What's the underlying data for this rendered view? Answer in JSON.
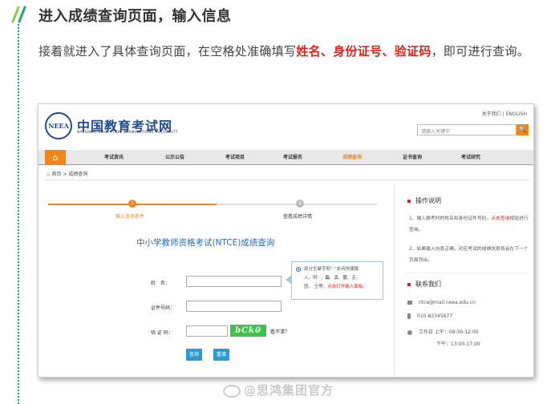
{
  "article": {
    "heading": "进入成绩查询页面，输入信息",
    "intro_before": "接着就进入了具体查询页面，在空格处准确填写",
    "intro_highlight": "姓名、身份证号、验证码",
    "intro_after": "，即可进行查询。"
  },
  "site": {
    "logo_mark": "NEEA",
    "logo_cn": "中国教育考试网",
    "logo_en": "NATIONAL EDUCATION EXAMINATIONS AUTHORITY",
    "top_links": "关于我们 | ENGLISH",
    "search_placeholder": "请输入关键字",
    "search_icon": "magnifier-icon",
    "accent_color": "#f08519",
    "brand_color": "#1f4c8f",
    "home_glyph": "⌂",
    "search_glyph": "🔍"
  },
  "nav": {
    "items": [
      "考试资讯",
      "公示公告",
      "考试项目",
      "考试报名",
      "成绩查询",
      "证书查询",
      "考试研究"
    ],
    "active": "成绩查询"
  },
  "breadcrumb": {
    "home_icon": "⌂",
    "text": "首页 > 成绩查询"
  },
  "steps": {
    "step1_num": "1",
    "step1_label": "输入查询条件",
    "step2_num": "2",
    "step2_label": "查看成绩详情"
  },
  "form": {
    "title": "中小学教师资格考试(NTCE)成绩查询",
    "name_label": "姓　名：",
    "id_label": "证件号码：",
    "captcha_label": "验 证 码：",
    "captcha_text": "bCk0",
    "captcha_tip": "看不清？",
    "query_button": "查询",
    "reset_button": "重填"
  },
  "hint": {
    "line1": "部分生僻字和“·”支持快捷输",
    "line2": "入，例：·、龘、䶮、䨻、㐊、",
    "line3": "㘝、 仝等，",
    "link": "点击打开输入面板。"
  },
  "sidebar": {
    "ops_title": "操作说明",
    "ops_1": "1、输入报考时的姓名和身份证件号码，",
    "ops_1_link": "点击查询",
    "ops_1_end": "按钮进行查询。",
    "ops_2": "2、如果输入信息正确，对应考试的成绩信息将会在下一个页面列出。",
    "contact_title": "联系我们",
    "email": "ntce@mail.neea.edu.cn",
    "phone": "010-82345677",
    "hours_1": "工作日 上午：08:30-12:00",
    "hours_2": "下午：13:00-17:00"
  },
  "watermark": {
    "text": "@思鸿集团官方"
  }
}
